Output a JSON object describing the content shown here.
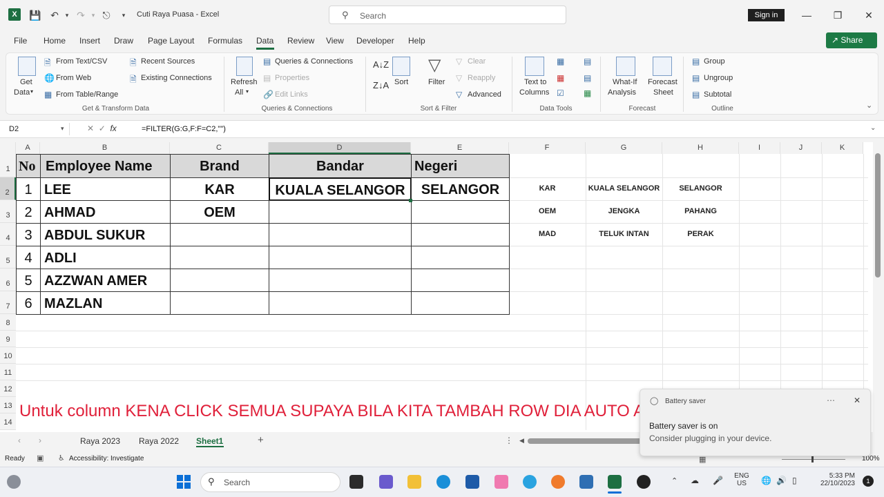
{
  "titlebar": {
    "app_icon": "excel-icon",
    "doc_title": "Cuti Raya Puasa  -  Excel",
    "search_placeholder": "Search",
    "signin_label": "Sign in",
    "search_icon": "search-icon"
  },
  "menu": {
    "tabs": [
      "File",
      "Home",
      "Insert",
      "Draw",
      "Page Layout",
      "Formulas",
      "Data",
      "Review",
      "View",
      "Developer",
      "Help"
    ],
    "active_tab": "Data",
    "share_label": "Share"
  },
  "ribbon": {
    "get_data": {
      "line1": "Get",
      "line2": "Data"
    },
    "from_text_csv": "From Text/CSV",
    "from_web": "From Web",
    "from_table_range": "From Table/Range",
    "recent_sources": "Recent Sources",
    "existing_connections": "Existing Connections",
    "group_get_transform": "Get & Transform Data",
    "refresh_all": {
      "line1": "Refresh",
      "line2": "All"
    },
    "queries_connections": "Queries & Connections",
    "properties": "Properties",
    "edit_links": "Edit Links",
    "group_queries": "Queries & Connections",
    "sort": "Sort",
    "filter": "Filter",
    "clear": "Clear",
    "reapply": "Reapply",
    "advanced": "Advanced",
    "group_sort_filter": "Sort & Filter",
    "text_to_columns": {
      "line1": "Text to",
      "line2": "Columns"
    },
    "group_data_tools": "Data Tools",
    "what_if": {
      "line1": "What-If",
      "line2": "Analysis"
    },
    "forecast_sheet": {
      "line1": "Forecast",
      "line2": "Sheet"
    },
    "group_forecast": "Forecast",
    "group_btn": "Group",
    "ungroup_btn": "Ungroup",
    "subtotal_btn": "Subtotal",
    "group_outline": "Outline"
  },
  "formula_bar": {
    "name_box": "D2",
    "formula": "=FILTER(G:G,F:F=C2,\"\")"
  },
  "columns": [
    "A",
    "B",
    "C",
    "D",
    "E",
    "F",
    "G",
    "H",
    "I",
    "J",
    "K"
  ],
  "rows": [
    "1",
    "2",
    "3",
    "4",
    "5",
    "6",
    "7",
    "8",
    "9",
    "10",
    "11",
    "12",
    "13",
    "14"
  ],
  "table": {
    "headers": [
      "No",
      "Employee Name",
      "Brand",
      "Bandar",
      "Negeri"
    ],
    "rows": [
      [
        "1",
        "LEE",
        "KAR",
        "KUALA SELANGOR",
        "SELANGOR"
      ],
      [
        "2",
        "AHMAD",
        "OEM",
        "",
        ""
      ],
      [
        "3",
        "ABDUL SUKUR",
        "",
        "",
        ""
      ],
      [
        "4",
        "ADLI",
        "",
        "",
        ""
      ],
      [
        "5",
        "AZZWAN AMER",
        "",
        "",
        ""
      ],
      [
        "6",
        "MAZLAN",
        "",
        "",
        ""
      ]
    ]
  },
  "lookup": [
    [
      "KAR",
      "KUALA SELANGOR",
      "SELANGOR"
    ],
    [
      "OEM",
      "JENGKA",
      "PAHANG"
    ],
    [
      "MAD",
      "TELUK INTAN",
      "PERAK"
    ]
  ],
  "caption": "Untuk column KENA CLICK SEMUA SUPAYA BILA KITA TAMBAH ROW DIA AUTO ADA FORMAT",
  "sheets": [
    "Raya 2023",
    "Raya 2022",
    "Sheet1"
  ],
  "active_sheet": "Sheet1",
  "status": {
    "ready": "Ready",
    "accessibility": "Accessibility: Investigate",
    "zoom": "100%"
  },
  "toast": {
    "header": "Battery saver",
    "title": "Battery saver is on",
    "body": "Consider plugging in your device."
  },
  "taskbar": {
    "search_placeholder": "Search",
    "lang_top": "ENG",
    "lang_bottom": "US",
    "time": "5:33 PM",
    "date": "22/10/2023",
    "notif_count": "1"
  },
  "colors": {
    "excel_green": "#1d6f42",
    "caption_red": "#e0203a",
    "header_fill": "#d9d9d9"
  }
}
